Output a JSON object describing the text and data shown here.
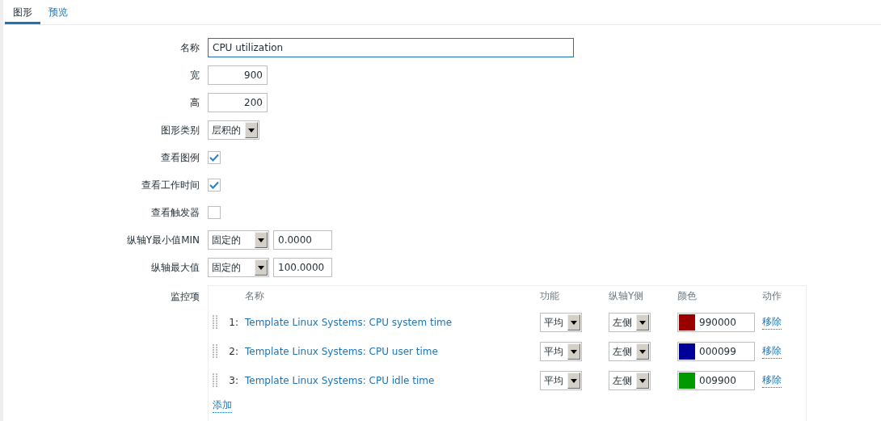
{
  "tabs": [
    {
      "label": "图形",
      "selected": true
    },
    {
      "label": "预览",
      "selected": false
    }
  ],
  "form": [
    {
      "kind": "text",
      "label": "名称",
      "value": "CPU utilization"
    },
    {
      "kind": "number",
      "label": "宽",
      "value": "900"
    },
    {
      "kind": "number",
      "label": "高",
      "value": "200"
    },
    {
      "kind": "select",
      "label": "图形类别",
      "value": "层积的"
    },
    {
      "kind": "checkbox",
      "label": "查看图例",
      "checked": true
    },
    {
      "kind": "checkbox",
      "label": "查看工作时间",
      "checked": true
    },
    {
      "kind": "checkbox",
      "label": "查看触发器",
      "checked": false
    },
    {
      "kind": "select_value",
      "label": "纵轴Y最小值MIN",
      "value": "固定的",
      "amount": "0.0000"
    },
    {
      "kind": "select_value",
      "label": "纵轴最大值",
      "value": "固定的",
      "amount": "100.0000"
    }
  ],
  "items": {
    "label": "监控项",
    "columns": [
      "名称",
      "功能",
      "纵轴Y侧",
      "颜色",
      "动作"
    ],
    "rows": [
      {
        "number": "1:",
        "name": "Template Linux Systems: CPU system time",
        "function": "平均",
        "y_side": "左侧",
        "color": "#990000",
        "color_code": "990000",
        "action": "移除"
      },
      {
        "number": "2:",
        "name": "Template Linux Systems: CPU user time",
        "function": "平均",
        "y_side": "左侧",
        "color": "#000099",
        "color_code": "000099",
        "action": "移除"
      },
      {
        "number": "3:",
        "name": "Template Linux Systems: CPU idle time",
        "function": "平均",
        "y_side": "左侧",
        "color": "#009900",
        "color_code": "009900",
        "action": "移除"
      }
    ],
    "add": "添加"
  }
}
